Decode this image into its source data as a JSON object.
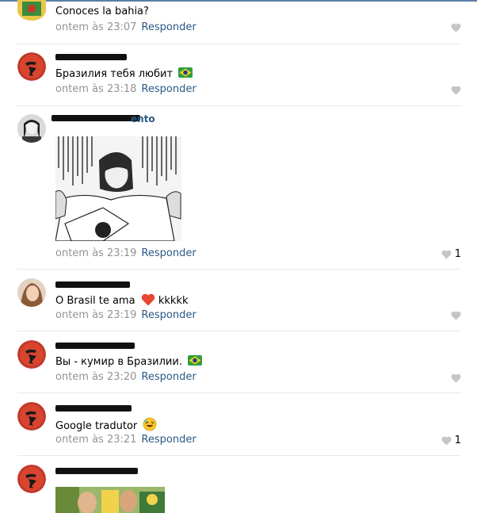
{
  "comments": [
    {
      "text": "Conoces la bahia?",
      "time": "ontem às 23:07",
      "reply": "Responder",
      "likes": ""
    },
    {
      "text": "Бразилия тебя любит",
      "time": "ontem às 23:18",
      "reply": "Responder",
      "likes": ""
    },
    {
      "time": "ontem às 23:19",
      "reply": "Responder",
      "likes": "1",
      "name_tail": "ento"
    },
    {
      "text": "O Brasil te ama",
      "text2": "kkkkk",
      "time": "ontem às 23:19",
      "reply": "Responder",
      "likes": ""
    },
    {
      "text": "Вы - кумир в Бразилии.",
      "time": "ontem às 23:20",
      "reply": "Responder",
      "likes": ""
    },
    {
      "text": "Google tradutor",
      "time": "ontem às 23:21",
      "reply": "Responder",
      "likes": "1"
    },
    {}
  ],
  "colors": {
    "link": "#2a5885",
    "meta": "#939393",
    "like": "#828282"
  },
  "icons": {
    "like": "heart-icon",
    "flag": "brazil-flag-icon",
    "love": "red-heart-emoji",
    "laugh": "rofl-emoji"
  }
}
